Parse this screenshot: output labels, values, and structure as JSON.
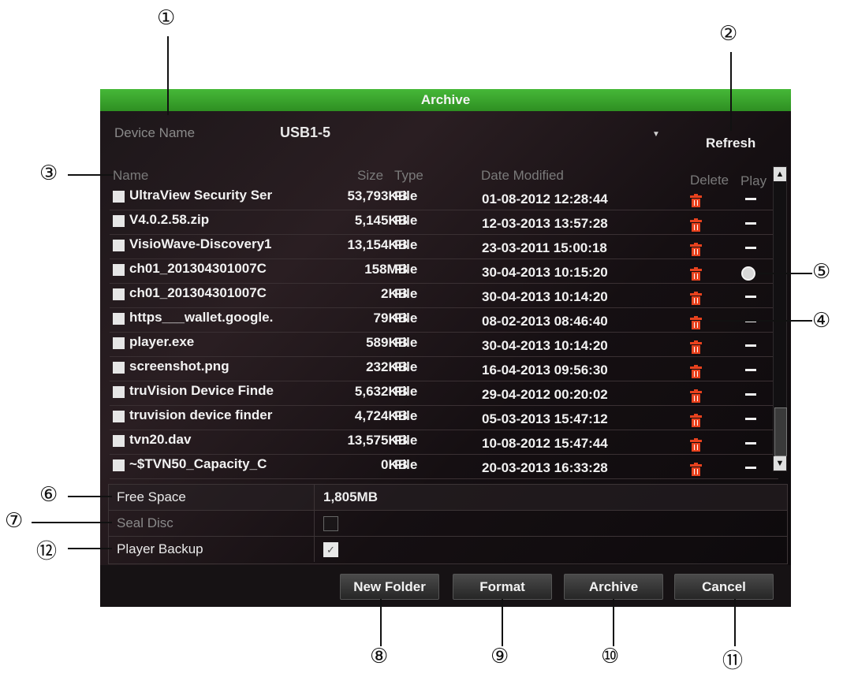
{
  "window": {
    "title": "Archive"
  },
  "device": {
    "label": "Device Name",
    "value": "USB1-5",
    "refresh_label": "Refresh"
  },
  "columns": {
    "name": "Name",
    "size": "Size",
    "type": "Type",
    "date": "Date Modified",
    "delete": "Delete",
    "play": "Play"
  },
  "files": [
    {
      "name": "UltraView Security Ser",
      "size": "53,793KB",
      "type": "File",
      "date": "01-08-2012 12:28:44",
      "playable": false
    },
    {
      "name": "V4.0.2.58.zip",
      "size": "5,145KB",
      "type": "File",
      "date": "12-03-2013 13:57:28",
      "playable": false
    },
    {
      "name": "VisioWave-Discovery1",
      "size": "13,154KB",
      "type": "File",
      "date": "23-03-2011 15:00:18",
      "playable": false
    },
    {
      "name": "ch01_201304301007C",
      "size": "158MB",
      "type": "File",
      "date": "30-04-2013 10:15:20",
      "playable": true
    },
    {
      "name": "ch01_201304301007C",
      "size": "2KB",
      "type": "File",
      "date": "30-04-2013 10:14:20",
      "playable": false
    },
    {
      "name": "https___wallet.google.",
      "size": "79KB",
      "type": "File",
      "date": "08-02-2013 08:46:40",
      "playable": false
    },
    {
      "name": "player.exe",
      "size": "589KB",
      "type": "File",
      "date": "30-04-2013 10:14:20",
      "playable": false
    },
    {
      "name": "screenshot.png",
      "size": "232KB",
      "type": "File",
      "date": "16-04-2013 09:56:30",
      "playable": false
    },
    {
      "name": "truVision Device Finde",
      "size": "5,632KB",
      "type": "File",
      "date": "29-04-2012 00:20:02",
      "playable": false
    },
    {
      "name": "truvision device finder",
      "size": "4,724KB",
      "type": "File",
      "date": "05-03-2013 15:47:12",
      "playable": false
    },
    {
      "name": "tvn20.dav",
      "size": "13,575KB",
      "type": "File",
      "date": "10-08-2012 15:47:44",
      "playable": false
    },
    {
      "name": "~$TVN50_Capacity_C",
      "size": "0KB",
      "type": "File",
      "date": "20-03-2013 16:33:28",
      "playable": false
    }
  ],
  "info": {
    "free_space_label": "Free Space",
    "free_space_value": "1,805MB",
    "seal_disc_label": "Seal Disc",
    "seal_disc_checked": false,
    "player_backup_label": "Player Backup",
    "player_backup_checked": true
  },
  "buttons": {
    "new_folder": "New Folder",
    "format": "Format",
    "archive": "Archive",
    "cancel": "Cancel"
  },
  "callouts": [
    "①",
    "②",
    "③",
    "④",
    "⑤",
    "⑥",
    "⑦",
    "⑧",
    "⑨",
    "⑩",
    "⑪",
    "⑫"
  ],
  "colors": {
    "titlebar": "#3aa52d",
    "trash": "#e8421e",
    "panel": "#141013"
  }
}
